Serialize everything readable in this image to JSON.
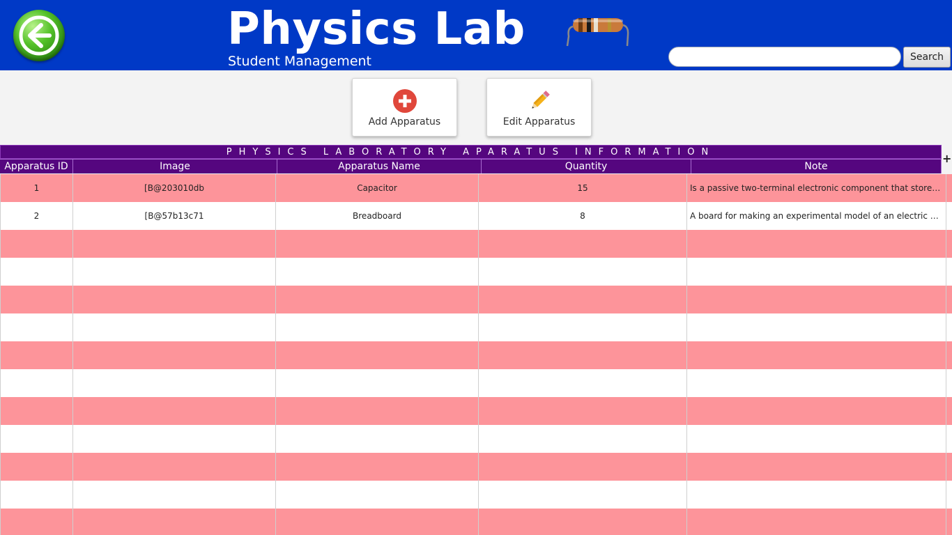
{
  "header": {
    "title": "Physics Lab",
    "subtitle": "Student Management",
    "back_icon": "back-arrow-icon",
    "decor_icon": "resistor-icon",
    "search": {
      "value": "",
      "placeholder": "",
      "button_label": "Search"
    }
  },
  "toolbar": {
    "add_label": "Add Apparatus",
    "add_icon": "plus-circle-icon",
    "edit_label": "Edit Apparatus",
    "edit_icon": "pencil-icon"
  },
  "table": {
    "banner": "PHYSICS LABORATORY APARATUS INFORMATION",
    "columns": [
      "Apparatus ID",
      "Image",
      "Apparatus Name",
      "Quantity",
      "Note"
    ],
    "rows": [
      [
        "1",
        "[B@203010db",
        "Capacitor",
        "15",
        "Is a passive two-terminal electronic component that stores electrical energy"
      ],
      [
        "2",
        "[B@57b13c71",
        "Breadboard",
        "8",
        "A board for making an experimental model of an electric circuit"
      ]
    ],
    "empty_rows": 11
  },
  "colors": {
    "header_bg": "#0039c6",
    "table_header_bg": "#55067f",
    "row_pink": "#fd949a",
    "row_white": "#ffffff"
  }
}
